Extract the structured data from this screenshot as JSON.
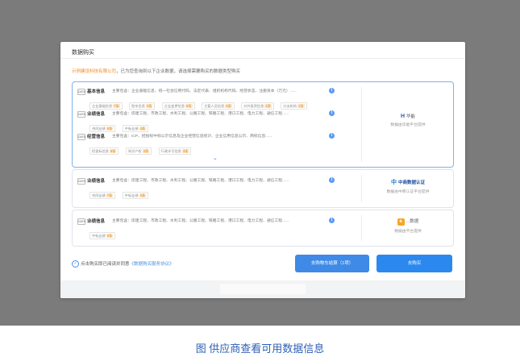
{
  "modal": {
    "title": "数据购买",
    "intro_org": "示例建设科技有限公司",
    "intro_text": "，已为您查询到以下企业数据，请选择需要购买的数据类型购买"
  },
  "cards": [
    {
      "selected": true,
      "rows": [
        {
          "checkbox_text": "DATA",
          "name": "基本信息",
          "desc": "主要包含：企业基础信息、统一社会信用代码、法定代表、组织机构代码、经营状态、注册资本（万元）......",
          "tags": [
            {
              "label": "企业基础信息",
              "count": "7条"
            },
            {
              "label": "股东信息",
              "count": "3条"
            },
            {
              "label": "企业变更信息",
              "count": "5条"
            },
            {
              "label": "主要人员信息",
              "count": "4条"
            },
            {
              "label": "对外投资信息",
              "count": "2条"
            },
            {
              "label": "分支机构",
              "count": "1条"
            }
          ]
        },
        {
          "checkbox_text": "DATA",
          "name": "业绩信息",
          "desc": "主要包含：房建工程、市政工程、水利工程、公路工程、铁路工程、港口工程、电力工程、通信工程......",
          "tags": [
            {
              "label": "合同业绩",
              "count": "6条"
            },
            {
              "label": "中标业绩",
              "count": "4条"
            }
          ]
        },
        {
          "checkbox_text": "DATA",
          "name": "经营信息",
          "desc": "主要包含：ICP、招投标中标公示信息及企业经营信息统计、企业信用信息公示、商标信息......",
          "tags": [
            {
              "label": "招投标信息",
              "count": "8条"
            },
            {
              "label": "知识产权",
              "count": "2条"
            },
            {
              "label": "行政许可信息",
              "count": "3条"
            }
          ]
        }
      ],
      "expand_icon": "chevron-down-icon",
      "brand": {
        "logo_mark": "H",
        "logo_text": "华能",
        "sub": "数据由华能平台提供"
      }
    },
    {
      "selected": false,
      "rows": [
        {
          "checkbox_text": "DATA",
          "name": "业绩信息",
          "desc": "主要包含：房建工程、市政工程、水利工程、公路工程、铁路工程、港口工程、电力工程、通信工程......",
          "tags": [
            {
              "label": "合同业绩",
              "count": "7条"
            },
            {
              "label": "中标业绩",
              "count": "3条"
            }
          ]
        }
      ],
      "brand": {
        "logo_mark": "中",
        "logo_text": "中商数据认证",
        "sub": "数据由中商认证平台提供"
      }
    },
    {
      "selected": false,
      "rows": [
        {
          "checkbox_text": "DATA",
          "name": "业绩信息",
          "desc": "主要包含：房建工程、市政工程、水利工程、公路工程、铁路工程、港口工程、电力工程、通信工程......",
          "tags": [
            {
              "label": "中标业绩",
              "count": "5条"
            }
          ]
        }
      ],
      "brand": {
        "logo_mark": "e",
        "logo_text": "...数据",
        "sub": "数据由平台提供"
      }
    }
  ],
  "footer": {
    "agree_text": "点击购买即已阅读并同意",
    "agree_link": "《数据购买服务协议》",
    "add_cart_label": "去购物车结算（1项）",
    "buy_label": "去购买"
  },
  "caption": "图  供应商查看可用数据信息",
  "colors": {
    "primary": "#2b88ee",
    "accent_orange": "#f08a24",
    "backdrop": "#7b7b7b",
    "caption": "#2d5fb6"
  }
}
